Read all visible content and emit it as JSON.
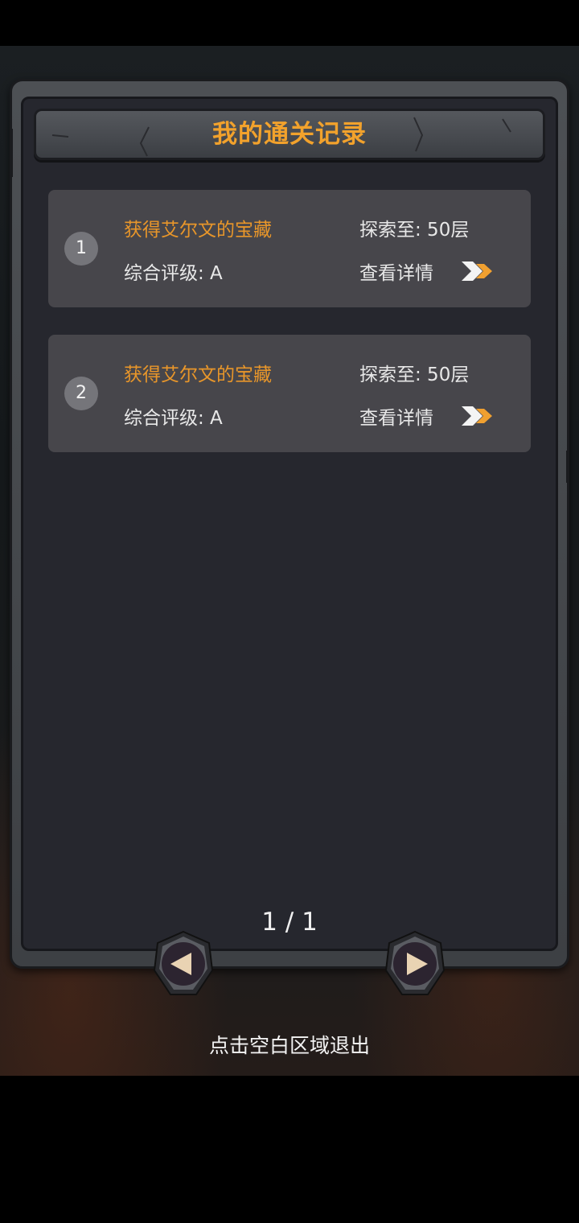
{
  "panel": {
    "title": "我的通关记录"
  },
  "records": [
    {
      "rank": "1",
      "name": "获得艾尔文的宝藏",
      "grade": "综合评级: A",
      "floor": "探索至: 50层",
      "detail": "查看详情"
    },
    {
      "rank": "2",
      "name": "获得艾尔文的宝藏",
      "grade": "综合评级: A",
      "floor": "探索至: 50层",
      "detail": "查看详情"
    }
  ],
  "pagination": {
    "indicator": "1 / 1"
  },
  "footer": {
    "hint": "点击空白区域退出"
  },
  "colors": {
    "accent": "#f2a22c",
    "card": "#47464b",
    "panel": "#26272e"
  },
  "icons": {
    "prev": "left-triangle-icon",
    "next": "right-triangle-icon",
    "detail": "double-chevron-right-icon"
  }
}
